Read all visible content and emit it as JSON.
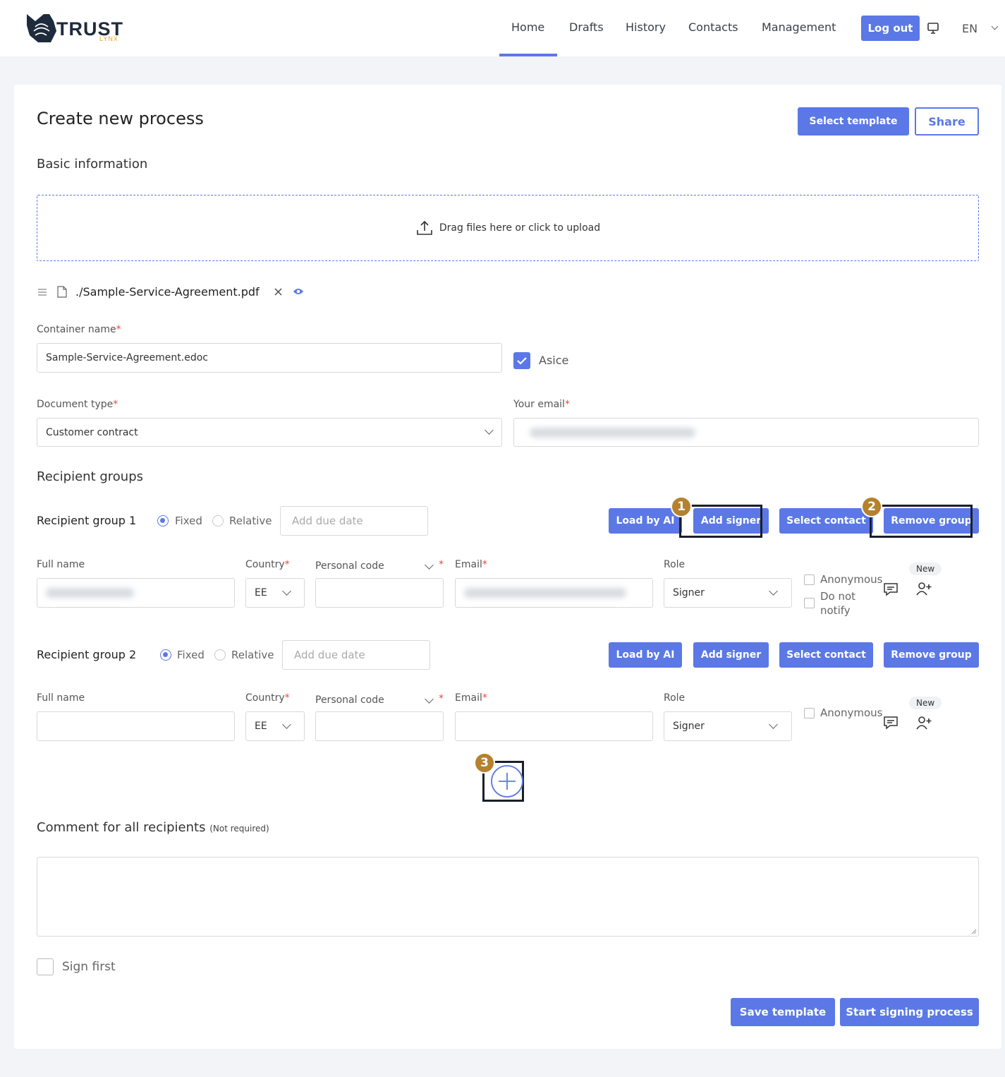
{
  "header": {
    "logo_text": "TRUST",
    "logo_sub": "LYNX",
    "nav": [
      "Home",
      "Drafts",
      "History",
      "Contacts",
      "Management"
    ],
    "logout_label": "Log out",
    "language": "EN"
  },
  "page": {
    "title": "Create new process",
    "select_template_label": "Select template",
    "share_label": "Share"
  },
  "basic": {
    "heading": "Basic information",
    "upload_text": "Drag files here or click to upload",
    "file_name": "./Sample-Service-Agreement.pdf",
    "container_label": "Container name",
    "container_value": "Sample-Service-Agreement.edoc",
    "asice_label": "Asice",
    "doctype_label": "Document type",
    "doctype_value": "Customer contract",
    "email_label": "Your email"
  },
  "recipients": {
    "heading": "Recipient groups",
    "groups": [
      {
        "title": "Recipient group 1",
        "fixed": "Fixed",
        "relative": "Relative",
        "due_placeholder": "Add due date",
        "buttons": [
          "Load by AI",
          "Add signer",
          "Select contact",
          "Remove group"
        ],
        "labels": {
          "full_name": "Full name",
          "country": "Country",
          "personal_code": "Personal code",
          "email": "Email",
          "role": "Role"
        },
        "country": "EE",
        "role": "Signer",
        "anonymous": "Anonymous",
        "do_not": "Do not",
        "notify": "notify",
        "new": "New"
      },
      {
        "title": "Recipient group 2",
        "fixed": "Fixed",
        "relative": "Relative",
        "due_placeholder": "Add due date",
        "buttons": [
          "Load by AI",
          "Add signer",
          "Select contact",
          "Remove group"
        ],
        "labels": {
          "full_name": "Full name",
          "country": "Country",
          "personal_code": "Personal code",
          "email": "Email",
          "role": "Role"
        },
        "country": "EE",
        "role": "Signer",
        "anonymous": "Anonymous",
        "new": "New"
      }
    ]
  },
  "comment": {
    "heading": "Comment for all recipients",
    "note": "(Not required)"
  },
  "sign_first_label": "Sign first",
  "footer": {
    "save_template_label": "Save template",
    "start_label": "Start signing process"
  },
  "annotations": [
    "1",
    "2",
    "3"
  ],
  "colors": {
    "accent": "#5b78e6",
    "badge": "#b5812d"
  }
}
